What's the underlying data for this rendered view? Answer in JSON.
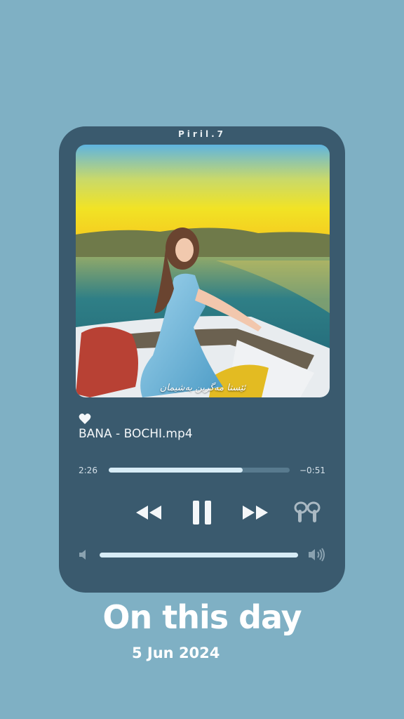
{
  "player": {
    "handle": "Piril.7",
    "artwork_caption": "ئێستا مەگرین بەشیمان",
    "track_title": "BANA - BOCHI.mp4",
    "time_elapsed": "2:26",
    "time_remaining": "−0:51",
    "progress_fraction": 0.74,
    "volume_fraction": 1.0,
    "liked": true,
    "controls": {
      "rewind_icon": "rewind-icon",
      "pause_icon": "pause-icon",
      "forward_icon": "fast-forward-icon",
      "output_icon": "airpods-icon"
    }
  },
  "memory": {
    "headline": "On this day",
    "date": "5 Jun 2024"
  },
  "colors": {
    "background": "#7fb0c4",
    "card": "#3a5a6e",
    "accent": "#d7ecf6"
  }
}
